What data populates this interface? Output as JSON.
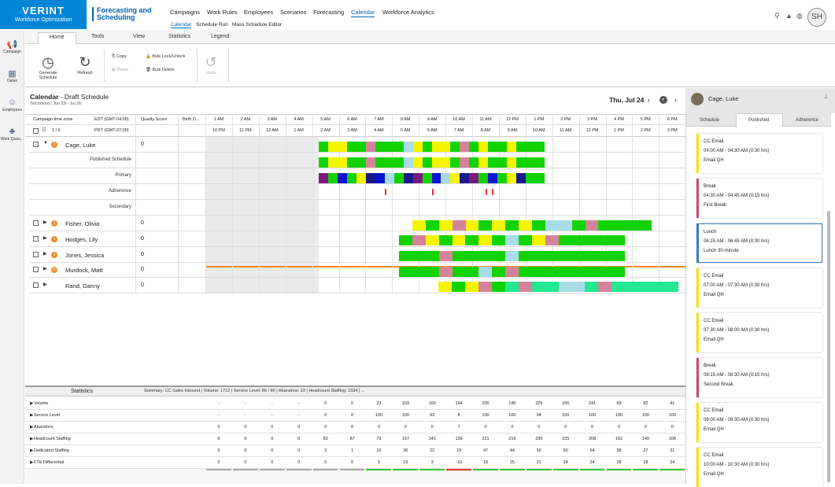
{
  "brand": {
    "name": "VERINT",
    "sub": "Workforce Optimization",
    "product": "Forecasting and Scheduling"
  },
  "nav": [
    "Campaigns",
    "Work Rules",
    "Employees",
    "Scenarios",
    "Forecasting",
    "Calendar",
    "Workforce Analytics"
  ],
  "subnav": [
    "Calendar",
    "Schedule Run",
    "Mass Schedule Editor"
  ],
  "user_initials": "SH",
  "leftnav": [
    "Campaign",
    "Dates",
    "Employees",
    "Work Queu..."
  ],
  "ribbon_tabs": [
    "Home",
    "Tools",
    "View",
    "Statistics",
    "Legend"
  ],
  "ribbon": {
    "generate": "Generate Schedule",
    "refresh": "Refresh",
    "copy": "Copy",
    "paste": "Paste",
    "bulk_lock": "Bulk Lock/Unlock",
    "bulk_delete": "Bulk Delete",
    "undo": "Undo"
  },
  "calendar": {
    "title": "Calendar",
    "title2": " - Draft Schedule",
    "sub": "Telcomind | Jun 29 - Jul 26",
    "date": "Thu, Jul 24"
  },
  "grid_head": {
    "campaign_tz": "Campaign time zone",
    "edt": "EDT (GMT-04:00)",
    "pdt": "PDT (GMT-07:00)",
    "quality": "Quality Score",
    "birth": "Birth D...",
    "count": "1 / 6"
  },
  "times_edt": [
    "1 AM",
    "2 AM",
    "3 AM",
    "4 AM",
    "5 AM",
    "6 AM",
    "7 AM",
    "8 AM",
    "9 AM",
    "10 AM",
    "11 AM",
    "12 PM",
    "1 PM",
    "2 PM",
    "3 PM",
    "4 PM",
    "5 PM",
    "6 PM"
  ],
  "times_pdt": [
    "10 PM",
    "11 PM",
    "12 AM",
    "1 AM",
    "2 AM",
    "3 AM",
    "4 AM",
    "5 AM",
    "6 AM",
    "7 AM",
    "8 AM",
    "9 AM",
    "10 AM",
    "11 AM",
    "12 PM",
    "1 PM",
    "2 PM",
    "3 PM"
  ],
  "employees": [
    {
      "name": "Cage, Luke",
      "badge": "2",
      "score": "0"
    },
    {
      "name": "Fisher, Olivia",
      "badge": "2",
      "score": "0"
    },
    {
      "name": "Hodges, Lily",
      "badge": "1",
      "score": "0"
    },
    {
      "name": "Jones, Jessica",
      "badge": "2",
      "score": "0"
    },
    {
      "name": "Murdock, Matt",
      "badge": "10",
      "score": "0"
    },
    {
      "name": "Rand, Danny",
      "badge": "",
      "score": "0"
    }
  ],
  "subrows": [
    "Published Schedule",
    "Primary",
    "Adherence",
    "Secondary"
  ],
  "stats": {
    "label": "Statistics",
    "summary": "Summary: CC Sales Inbound  |  Volume: 1712  |  Service Level: 86 / 80  |  Abandons: 23  |  Headcount Staffing: 2334  |  ...",
    "rows": [
      {
        "name": "Volume",
        "vals": [
          "-",
          "-",
          "-",
          "-",
          "0",
          "0",
          "23",
          "103",
          "169",
          "194",
          "200",
          "146",
          "225",
          "166",
          "241",
          "69",
          "82",
          "41"
        ]
      },
      {
        "name": "Service Level",
        "vals": [
          "-",
          "-",
          "-",
          "-",
          "0",
          "0",
          "100",
          "100",
          "93",
          "8",
          "100",
          "100",
          "94",
          "100",
          "100",
          "100",
          "100",
          "100"
        ]
      },
      {
        "name": "Abandons",
        "vals": [
          "0",
          "0",
          "0",
          "0",
          "0",
          "0",
          "0",
          "0",
          "0",
          "7",
          "0",
          "0",
          "0",
          "0",
          "0",
          "0",
          "0",
          "0"
        ]
      },
      {
        "name": "Headcount Staffing",
        "vals": [
          "0",
          "0",
          "0",
          "0",
          "83",
          "87",
          "73",
          "157",
          "142",
          "136",
          "221",
          "216",
          "230",
          "225",
          "208",
          "162",
          "140",
          "108"
        ]
      },
      {
        "name": "Dedicated Staffing",
        "vals": [
          "0",
          "0",
          "0",
          "0",
          "3",
          "1",
          "10",
          "36",
          "22",
          "19",
          "47",
          "44",
          "50",
          "50",
          "54",
          "38",
          "27",
          "31"
        ]
      },
      {
        "name": "FTE Differential",
        "vals": [
          "0",
          "0",
          "0",
          "0",
          "0",
          "0",
          "5",
          "19",
          "3",
          "-10",
          "18",
          "25",
          "21",
          "24",
          "24",
          "28",
          "18",
          "24"
        ]
      }
    ]
  },
  "right_panel": {
    "name": "Cage, Luke",
    "tabs": [
      "Schedule",
      "Published",
      "Adherence"
    ],
    "cards": [
      {
        "kind": "email",
        "title": "CC Email",
        "time": "04:00 AM - 04:30 AM (0:30 hrs)",
        "desc": "Email QH"
      },
      {
        "kind": "break",
        "title": "Break",
        "time": "04:30 AM - 04:45 AM (0:15 hrs)",
        "desc": "First Break"
      },
      {
        "kind": "lunch",
        "title": "Lunch",
        "time": "06:15 AM - 06:45 AM (0:30 hrs)",
        "desc": "Lunch 30-minute"
      },
      {
        "kind": "email",
        "title": "CC Email",
        "time": "07:00 AM - 07:30 AM (0:30 hrs)",
        "desc": "Email QH"
      },
      {
        "kind": "email",
        "title": "CC Email",
        "time": "07:30 AM - 08:00 AM (0:30 hrs)",
        "desc": "Email QH"
      },
      {
        "kind": "break",
        "title": "Break",
        "time": "08:15 AM - 08:30 AM (0:15 hrs)",
        "desc": "Second Break"
      },
      {
        "kind": "email",
        "title": "CC Email",
        "time": "09:00 AM - 09:30 AM (0:30 hrs)",
        "desc": "Email QH"
      },
      {
        "kind": "email",
        "title": "CC Email",
        "time": "10:00 AM - 10:30 AM (0:30 hrs)",
        "desc": "Email QH"
      }
    ]
  },
  "colors": {
    "green": "#12d200",
    "yellow": "#f5f500",
    "lightblue": "#a8dce8",
    "break": "#d4849a",
    "navy": "#1a1a8c",
    "purple": "#7a1a7a",
    "blue": "#0a14d0",
    "mint": "#22e890",
    "orange": "#f08a24",
    "accent": "#0085d7"
  }
}
